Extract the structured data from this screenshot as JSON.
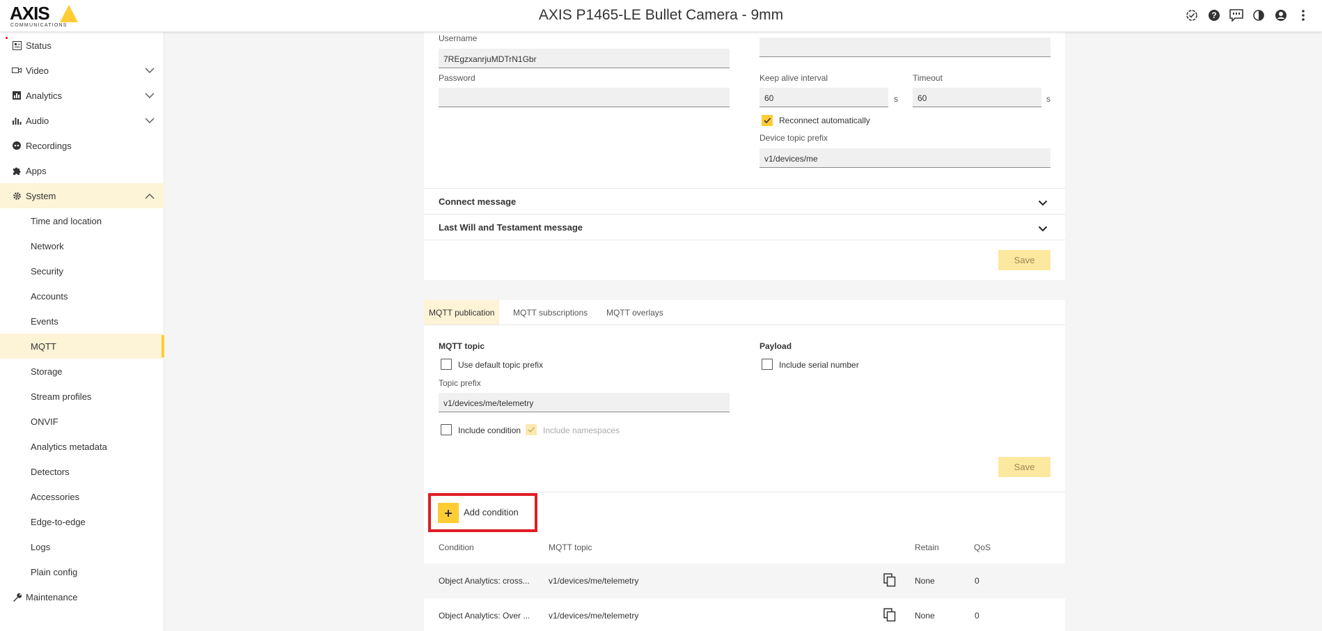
{
  "header": {
    "logo_word": "AXIS",
    "logo_sub": "COMMUNICATIONS",
    "title": "AXIS P1465-LE Bullet Camera - 9mm",
    "icons": [
      "status-check-icon",
      "help-icon",
      "feedback-icon",
      "contrast-icon",
      "user-icon",
      "more-icon"
    ]
  },
  "sidebar": {
    "items": [
      {
        "label": "Status",
        "icon": "status-icon"
      },
      {
        "label": "Video",
        "icon": "video-icon"
      },
      {
        "label": "Analytics",
        "icon": "analytics-icon"
      },
      {
        "label": "Audio",
        "icon": "audio-icon"
      },
      {
        "label": "Recordings",
        "icon": "recordings-icon"
      },
      {
        "label": "Apps",
        "icon": "apps-icon"
      },
      {
        "label": "System",
        "icon": "gear-icon"
      },
      {
        "label": "Maintenance",
        "icon": "wrench-icon"
      }
    ],
    "system_sub": [
      "Time and location",
      "Network",
      "Security",
      "Accounts",
      "Events",
      "MQTT",
      "Storage",
      "Stream profiles",
      "ONVIF",
      "Analytics metadata",
      "Detectors",
      "Accessories",
      "Edge-to-edge",
      "Logs",
      "Plain config"
    ],
    "active_sub": "MQTT"
  },
  "broker": {
    "username_label": "Username",
    "username_value": "7REgzxanrjuMDTrN1Gbr",
    "password_label": "Password",
    "password_value": "",
    "keepalive_label": "Keep alive interval",
    "keepalive_value": "60",
    "keepalive_unit": "s",
    "timeout_label": "Timeout",
    "timeout_value": "60",
    "timeout_unit": "s",
    "reconnect_label": "Reconnect automatically",
    "reconnect_checked": true,
    "topic_prefix_label": "Device topic prefix",
    "topic_prefix_value": "v1/devices/me",
    "connect_message": "Connect message",
    "lwt_message": "Last Will and Testament message",
    "save_label": "Save"
  },
  "publication": {
    "tabs": [
      "MQTT publication",
      "MQTT subscriptions",
      "MQTT overlays"
    ],
    "active_tab": "MQTT publication",
    "mqtt_topic_title": "MQTT topic",
    "use_default_label": "Use default topic prefix",
    "topic_prefix_label": "Topic prefix",
    "topic_prefix_value": "v1/devices/me/telemetry",
    "include_condition_label": "Include condition",
    "include_namespaces_label": "Include namespaces",
    "payload_title": "Payload",
    "include_serial_label": "Include serial number",
    "save_label": "Save"
  },
  "conditions": {
    "add_label": "Add condition",
    "columns": [
      "Condition",
      "MQTT topic",
      "Retain",
      "QoS"
    ],
    "rows": [
      {
        "condition": "Object Analytics: cross...",
        "topic": "v1/devices/me/telemetry",
        "retain": "None",
        "qos": "0"
      },
      {
        "condition": "Object Analytics: Over ...",
        "topic": "v1/devices/me/telemetry",
        "retain": "None",
        "qos": "0"
      }
    ]
  },
  "colors": {
    "accent": "#ffcc33",
    "active_bg": "#fdf3d6",
    "highlight_box": "#e01b24"
  }
}
